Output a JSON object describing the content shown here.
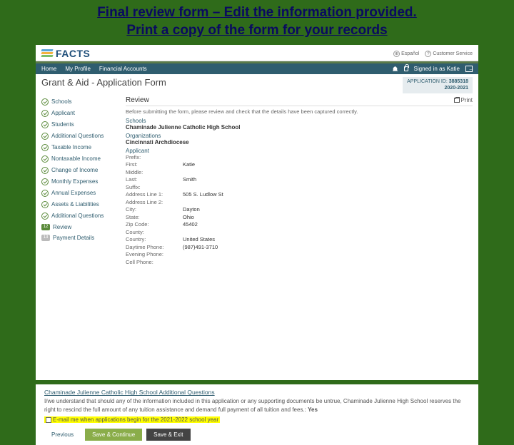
{
  "slide": {
    "title_line1": "Final review form – Edit the information provided.",
    "title_line2": "Print a copy of the form for your records"
  },
  "top": {
    "brand": "FACTS",
    "espanol": "Español",
    "customer_service": "Customer Service"
  },
  "nav": {
    "home": "Home",
    "my_profile": "My Profile",
    "financial": "Financial Accounts",
    "signed_in": "Signed in as Katie"
  },
  "page": {
    "title": "Grant & Aid - Application Form",
    "app_id_label": "APPLICATION ID:",
    "app_id_value": "3885318",
    "app_year": "2020-2021",
    "print": "Print"
  },
  "sidebar": {
    "items": [
      "Schools",
      "Applicant",
      "Students",
      "Additional Questions",
      "Taxable Income",
      "Nontaxable Income",
      "Change of Income",
      "Monthly Expenses",
      "Annual Expenses",
      "Assets & Liabilities",
      "Additional Questions"
    ],
    "review_step": "12",
    "review_label": "Review",
    "payment_step": "13",
    "payment_label": "Payment Details"
  },
  "main": {
    "heading": "Review",
    "intro": "Before submitting the form, please review and check that the details have been captured correctly.",
    "schools_label": "Schools",
    "schools_value": "Chaminade Julienne Catholic High School",
    "org_label": "Organizations",
    "org_value": "Cincinnati Archdiocese",
    "applicant_label": "Applicant",
    "fields": {
      "prefix_k": "Prefix:",
      "prefix_v": "",
      "first_k": "First:",
      "first_v": "Katie",
      "middle_k": "Middle:",
      "middle_v": "",
      "last_k": "Last:",
      "last_v": "Smith",
      "suffix_k": "Suffix:",
      "suffix_v": "",
      "addr1_k": "Address Line 1:",
      "addr1_v": "505 S. Ludlow St",
      "addr2_k": "Address Line 2:",
      "addr2_v": "",
      "city_k": "City:",
      "city_v": "Dayton",
      "state_k": "State:",
      "state_v": "Ohio",
      "zip_k": "Zip Code:",
      "zip_v": "45402",
      "county_k": "County:",
      "county_v": "",
      "country_k": "Country:",
      "country_v": "United States",
      "dayphone_k": "Daytime Phone:",
      "dayphone_v": "(987)491-3710",
      "evephone_k": "Evening Phone:",
      "evephone_v": "",
      "cell_k": "Cell Phone:",
      "cell_v": ""
    }
  },
  "lower": {
    "title": "Chaminade Julienne Catholic High School Additional Questions",
    "text": "I/we understand that should any of the information included in this application or any supporting documents be untrue, Chaminade Julienne High School reserves the right to rescind the full amount of any tuition assistance and demand full payment of all tuition and fees.:",
    "text_answer": "Yes",
    "opt_in": "E-mail me when applications begin for the 2021-2022 school year"
  },
  "buttons": {
    "previous": "Previous",
    "save_continue": "Save & Continue",
    "save_exit": "Save & Exit"
  }
}
